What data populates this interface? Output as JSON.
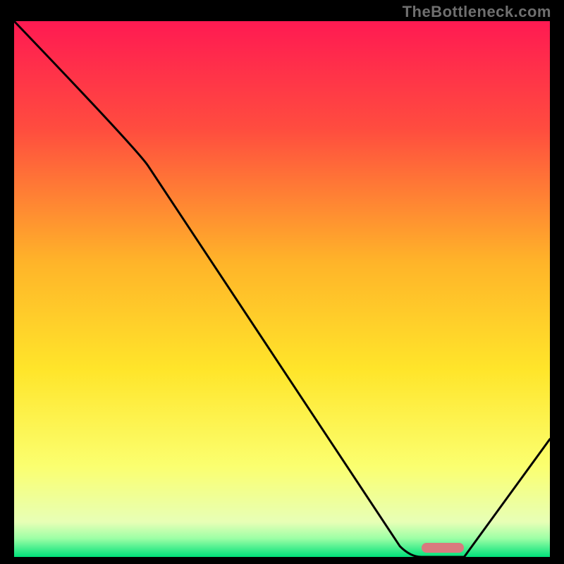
{
  "watermark": "TheBottleneck.com",
  "chart_data": {
    "type": "line",
    "title": "",
    "xlabel": "",
    "ylabel": "",
    "xlim": [
      0,
      100
    ],
    "ylim": [
      0,
      100
    ],
    "x": [
      0,
      25,
      72,
      76,
      84,
      100
    ],
    "values": [
      100,
      73,
      2,
      0,
      0,
      22
    ],
    "curve_description": "monotone-then-flat-then-rise V-shaped bottleneck curve",
    "marker": {
      "x_start": 76,
      "x_end": 84,
      "y": 0,
      "color": "#d97a7e"
    },
    "gradient_stops": [
      {
        "offset": 0.0,
        "color": "#ff1a52"
      },
      {
        "offset": 0.2,
        "color": "#ff4c3f"
      },
      {
        "offset": 0.45,
        "color": "#ffb429"
      },
      {
        "offset": 0.65,
        "color": "#ffe52a"
      },
      {
        "offset": 0.83,
        "color": "#fbff6f"
      },
      {
        "offset": 0.935,
        "color": "#e7ffb6"
      },
      {
        "offset": 0.965,
        "color": "#9effa6"
      },
      {
        "offset": 1.0,
        "color": "#00e17a"
      }
    ]
  }
}
